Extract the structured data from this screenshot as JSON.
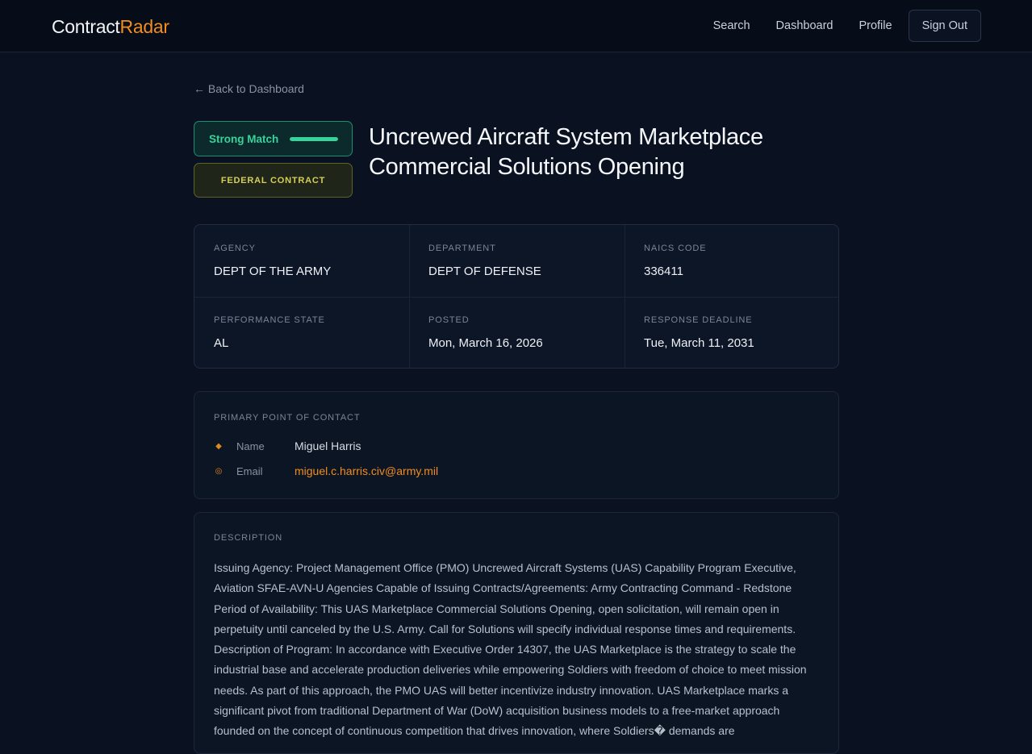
{
  "brand": {
    "part1": "Contract",
    "part2": "Radar"
  },
  "nav": {
    "search": "Search",
    "dashboard": "Dashboard",
    "profile": "Profile",
    "signout": "Sign Out"
  },
  "back_link": "← Back to Dashboard",
  "match": {
    "label": "Strong Match",
    "level_percent": 100
  },
  "contract_type": "FEDERAL CONTRACT",
  "title": "Uncrewed Aircraft System Marketplace Commercial Solutions Opening",
  "details": [
    {
      "label": "AGENCY",
      "value": "DEPT OF THE ARMY"
    },
    {
      "label": "DEPARTMENT",
      "value": "DEPT OF DEFENSE"
    },
    {
      "label": "NAICS CODE",
      "value": "336411"
    },
    {
      "label": "PERFORMANCE STATE",
      "value": "AL"
    },
    {
      "label": "POSTED",
      "value": "Mon, March 16, 2026"
    },
    {
      "label": "RESPONSE DEADLINE",
      "value": "Tue, March 11, 2031"
    }
  ],
  "contact": {
    "heading": "PRIMARY POINT OF CONTACT",
    "name_label": "Name",
    "name_value": "Miguel Harris",
    "email_label": "Email",
    "email_value": "miguel.c.harris.civ@army.mil"
  },
  "description": {
    "heading": "DESCRIPTION",
    "text": "Issuing Agency: Project Management Office (PMO) Uncrewed Aircraft Systems (UAS) Capability Program Executive, Aviation SFAE-AVN-U Agencies Capable of Issuing Contracts/Agreements: Army Contracting Command - Redstone Period of Availability: This UAS Marketplace Commercial Solutions Opening, open solicitation, will remain open in perpetuity until canceled by the U.S. Army. Call for Solutions will specify individual response times and requirements. Description of Program: In accordance with Executive Order 14307, the UAS Marketplace is the strategy to scale the industrial base and accelerate production deliveries while empowering Soldiers with freedom of choice to meet mission needs. As part of this approach, the PMO UAS will better incentivize industry innovation. UAS Marketplace marks a significant pivot from traditional Department of War (DoW) acquisition business models to a free-market approach founded on the concept of continuous competition that drives innovation, where Soldiers� demands are"
  },
  "colors": {
    "accent": "#f28c1e",
    "match_green": "#36d39a",
    "federal_yellow": "#d6ce57",
    "background": "#0a1120"
  }
}
